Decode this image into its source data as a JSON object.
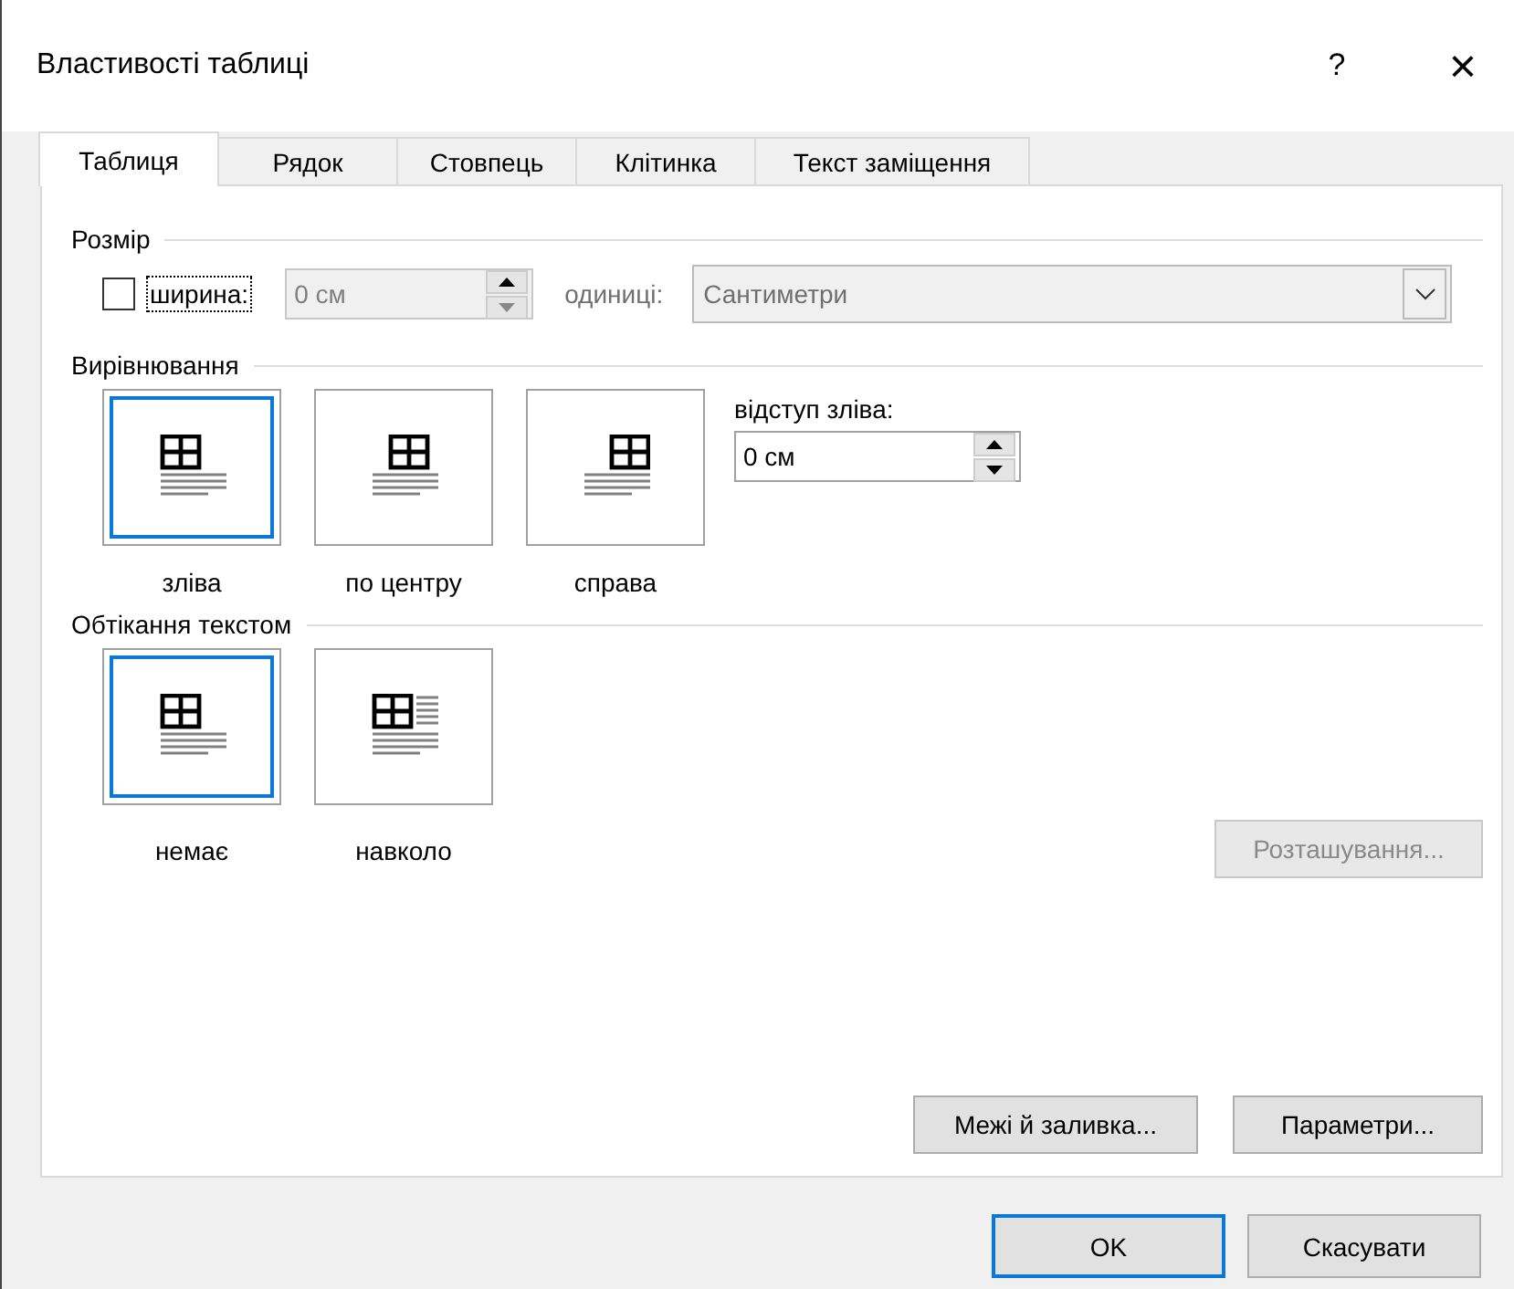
{
  "window": {
    "title": "Властивості таблиці",
    "help": "?",
    "close": "×"
  },
  "tabs": [
    {
      "label": "Таблиця",
      "selected": true
    },
    {
      "label": "Рядок",
      "selected": false
    },
    {
      "label": "Стовпець",
      "selected": false
    },
    {
      "label": "Клітинка",
      "selected": false
    },
    {
      "label": "Текст заміщення",
      "selected": false
    }
  ],
  "size": {
    "heading": "Розмір",
    "width_checkbox": {
      "label": "ширина:",
      "checked": false
    },
    "width_field": {
      "value": "0 см",
      "disabled": true
    },
    "units_label": "одиниці:",
    "units_select": {
      "value": "Сантиметри",
      "disabled": true
    }
  },
  "alignment": {
    "heading": "Вирівнювання",
    "options": [
      {
        "label": "зліва",
        "kind": "left",
        "selected": true
      },
      {
        "label": "по центру",
        "kind": "center",
        "selected": false
      },
      {
        "label": "справа",
        "kind": "right",
        "selected": false
      }
    ],
    "indent_label": "відступ зліва:",
    "indent_field": {
      "value": "0 см"
    }
  },
  "wrapping": {
    "heading": "Обтікання текстом",
    "options": [
      {
        "label": "немає",
        "kind": "none",
        "selected": true
      },
      {
        "label": "навколо",
        "kind": "around",
        "selected": false
      }
    ],
    "position_button": {
      "label": "Розташування...",
      "disabled": true
    }
  },
  "panel_buttons": [
    "Межі й заливка...",
    "Параметри..."
  ],
  "buttons": [
    {
      "label": "OK",
      "default": true
    },
    {
      "label": "Скасувати",
      "default": false
    }
  ]
}
